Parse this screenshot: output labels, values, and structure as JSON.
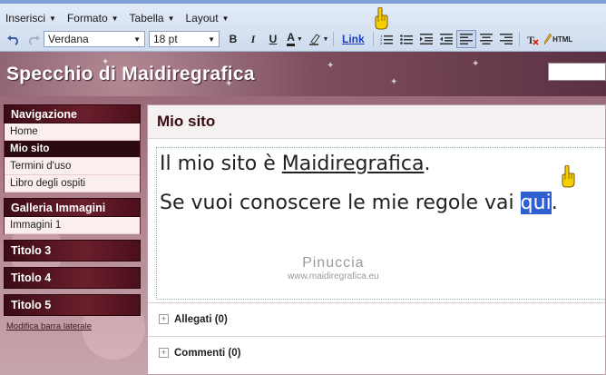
{
  "menubar": {
    "items": [
      {
        "label": "Inserisci"
      },
      {
        "label": "Formato"
      },
      {
        "label": "Tabella"
      },
      {
        "label": "Layout"
      }
    ]
  },
  "toolbar": {
    "font_family": "Verdana",
    "font_size": "18 pt",
    "bold": "B",
    "italic": "I",
    "underline": "U",
    "text_color": "A",
    "link_label": "Link",
    "html_label": "HTML"
  },
  "header": {
    "blog_title": "Specchio di Maidiregrafica"
  },
  "sidebar": {
    "widgets": [
      {
        "title": "Navigazione",
        "items": [
          "Home",
          "Mio sito",
          "Termini d'uso",
          "Libro degli ospiti"
        ],
        "selected": 1
      },
      {
        "title": "Galleria Immagini",
        "items": [
          "Immagini 1"
        ]
      },
      {
        "title": "Titolo 3",
        "items": []
      },
      {
        "title": "Titolo 4",
        "items": []
      },
      {
        "title": "Titolo 5",
        "items": []
      }
    ],
    "edit_link": "Modifica barra laterale"
  },
  "post": {
    "title": "Mio sito",
    "line1_prefix": "Il mio sito è ",
    "line1_link": "Maidiregrafica",
    "line1_suffix": ".",
    "line2_prefix": "Se vuoi conoscere le mie regole vai ",
    "line2_highlight": "qui",
    "line2_suffix": ".",
    "watermark_name": "Pinuccia",
    "watermark_url": "www.maidiregrafica.eu",
    "attachments": "Allegati (0)",
    "comments": "Commenti (0)"
  },
  "colors": {
    "accent_blue": "#2f5fd0",
    "sidebar_dark": "#3b0b14",
    "header": "#7d4e5d"
  }
}
